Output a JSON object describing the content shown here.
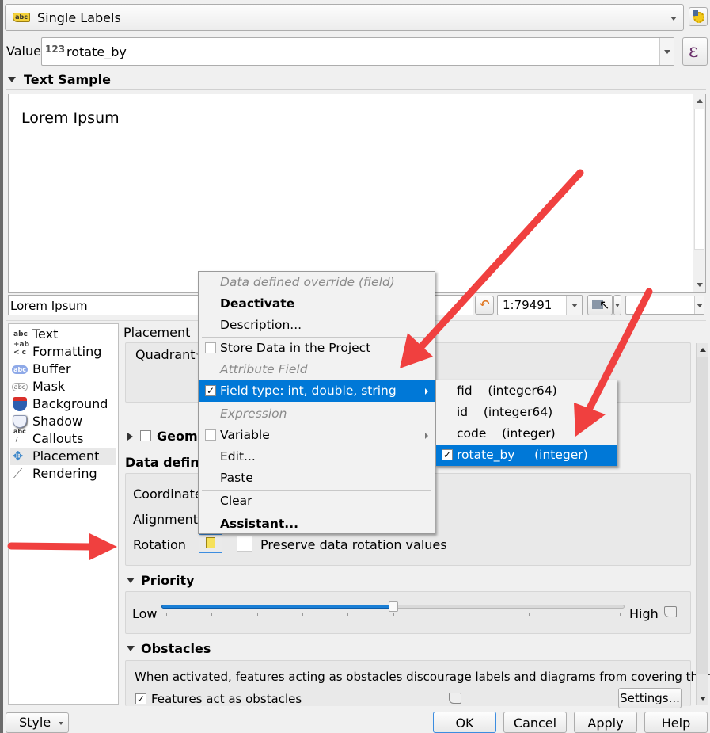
{
  "renderer_combo": {
    "icon": "label-abc-icon",
    "value": "Single Labels"
  },
  "value_row": {
    "label": "Value",
    "type_badge": "123",
    "value": "rotate_by",
    "expression_glyph": "ε"
  },
  "text_sample": {
    "title": "Text Sample",
    "preview_text": "Lorem Ipsum",
    "input_value": "Lorem Ipsum",
    "scale_value": "1:79491",
    "map_selector_value": ""
  },
  "sidebar": {
    "items": [
      {
        "label": "Text",
        "icon": "text-abc-icon",
        "selected": false
      },
      {
        "label": "Formatting",
        "icon": "formatting-icon",
        "selected": false
      },
      {
        "label": "Buffer",
        "icon": "buffer-icon",
        "selected": false
      },
      {
        "label": "Mask",
        "icon": "mask-icon",
        "selected": false
      },
      {
        "label": "Background",
        "icon": "background-shield-icon",
        "selected": false
      },
      {
        "label": "Shadow",
        "icon": "shadow-icon",
        "selected": false
      },
      {
        "label": "Callouts",
        "icon": "callouts-icon",
        "selected": false
      },
      {
        "label": "Placement",
        "icon": "placement-icon",
        "selected": true
      },
      {
        "label": "Rendering",
        "icon": "rendering-brush-icon",
        "selected": false
      }
    ]
  },
  "placement": {
    "heading": "Placement",
    "quadrant_label": "Quadrant",
    "geometry_section": "Geometry",
    "data_defined_heading": "Data defined",
    "coordinate_label": "Coordinate",
    "alignment_label": "Alignment",
    "rotation_label": "Rotation",
    "preserve_rotation_label": "Preserve data rotation values",
    "preserve_rotation_checked": false
  },
  "priority": {
    "title": "Priority",
    "low_label": "Low",
    "high_label": "High",
    "value_fraction": 0.5,
    "tick_count": 11
  },
  "obstacles": {
    "title": "Obstacles",
    "description": "When activated, features acting as obstacles discourage labels and diagrams from covering them.",
    "features_act_label": "Features act as obstacles",
    "features_act_checked": true,
    "settings_button": "Settings..."
  },
  "context_menu": {
    "header": "Data defined override (field)",
    "deactivate": "Deactivate",
    "description": "Description...",
    "store_data": "Store Data in the Project",
    "attribute_field_header": "Attribute Field",
    "field_type": "Field type: int, double, string",
    "expression_header": "Expression",
    "variable": "Variable",
    "edit": "Edit...",
    "paste": "Paste",
    "clear": "Clear",
    "assistant": "Assistant..."
  },
  "field_submenu": {
    "items": [
      {
        "name": "fid",
        "type": "(integer64)",
        "checked": false
      },
      {
        "name": "id",
        "type": "(integer64)",
        "checked": false
      },
      {
        "name": "code",
        "type": "(integer)",
        "checked": false
      },
      {
        "name": "rotate_by",
        "type": "(integer)",
        "checked": true
      }
    ]
  },
  "footer": {
    "style_button": "Style",
    "ok_button": "OK",
    "cancel_button": "Cancel",
    "apply_button": "Apply",
    "help_button": "Help"
  },
  "colors": {
    "highlight": "#0078d7",
    "annotation_arrow": "#f0403f",
    "slider_fill": "#1a7fd6"
  }
}
